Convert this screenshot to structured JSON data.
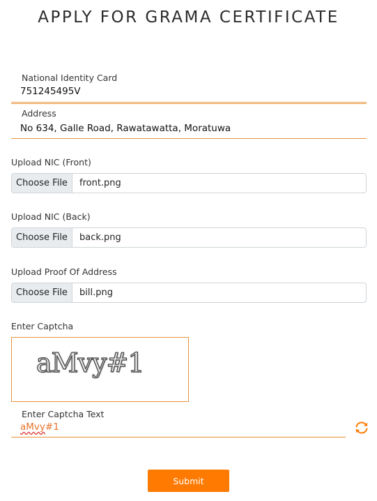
{
  "page": {
    "title": "APPLY FOR GRAMA CERTIFICATE"
  },
  "nic": {
    "label": "National Identity Card",
    "value": "751245495V"
  },
  "address": {
    "label": "Address",
    "value": "No 634, Galle Road, Rawatawatta, Moratuwa"
  },
  "uploads": [
    {
      "label": "Upload NIC (Front)",
      "button": "Choose File",
      "filename": "front.png"
    },
    {
      "label": "Upload NIC (Back)",
      "button": "Choose File",
      "filename": "back.png"
    },
    {
      "label": "Upload Proof Of Address",
      "button": "Choose File",
      "filename": "bill.png"
    }
  ],
  "captcha": {
    "section_label": "Enter Captcha",
    "image_text": "aMvy#1",
    "input_label": "Enter Captcha Text",
    "input_value_underlined": "aMvy",
    "input_value_rest": "#1"
  },
  "submit_label": "Submit",
  "colors": {
    "accent": "#ff7a00",
    "field_border": "#e8923a"
  },
  "icons": {
    "refresh": "refresh-icon"
  }
}
